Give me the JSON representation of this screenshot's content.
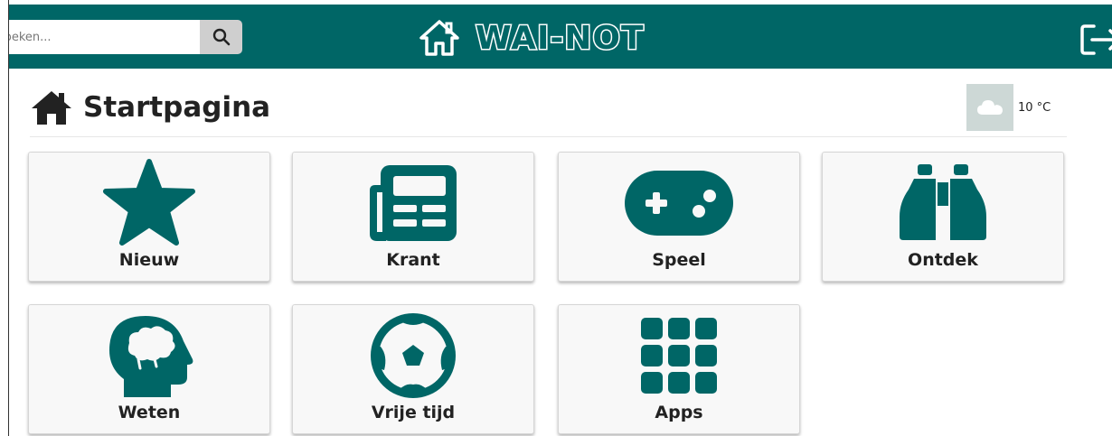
{
  "header": {
    "search_placeholder": "Zoeken...",
    "logo_text": "WAI-NOT",
    "search_icon": "magnifier-icon",
    "home_icon": "home-outline-icon",
    "logout_icon": "logout-icon"
  },
  "page": {
    "title": "Startpagina",
    "title_icon": "home-solid-icon"
  },
  "weather": {
    "icon": "cloud-icon",
    "temperature": "10 °C"
  },
  "tiles": [
    {
      "label": "Nieuw",
      "icon": "star-icon"
    },
    {
      "label": "Krant",
      "icon": "newspaper-icon"
    },
    {
      "label": "Speel",
      "icon": "gamepad-icon"
    },
    {
      "label": "Ontdek",
      "icon": "binoculars-icon"
    },
    {
      "label": "Weten",
      "icon": "brain-head-icon"
    },
    {
      "label": "Vrije tijd",
      "icon": "football-icon"
    },
    {
      "label": "Apps",
      "icon": "apps-grid-icon"
    }
  ],
  "colors": {
    "brand": "#006666",
    "tile_background": "#f8f8f8",
    "weather_box": "#cdd8d6"
  }
}
